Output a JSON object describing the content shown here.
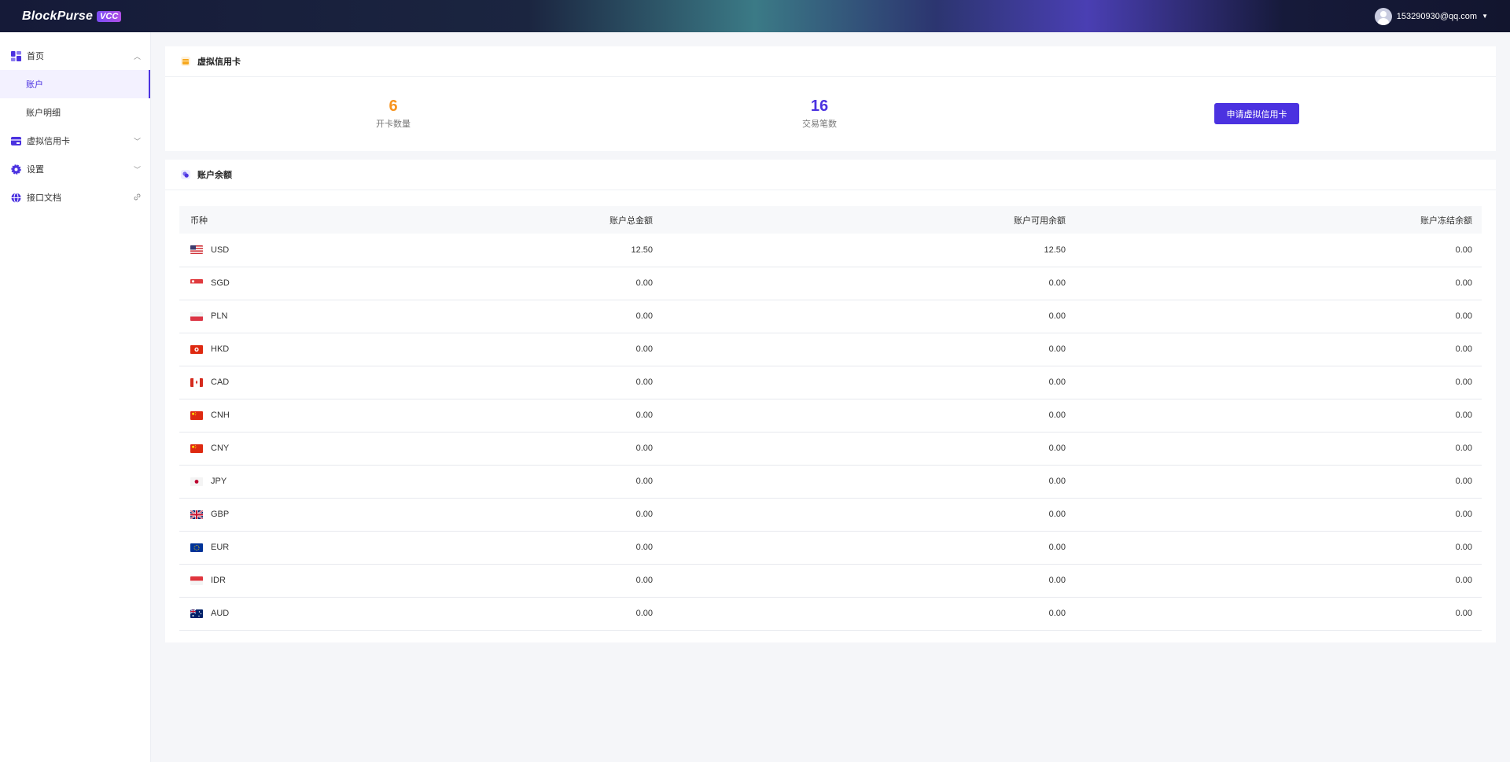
{
  "header": {
    "logo_text": "BlockPurse",
    "logo_badge": "VCC",
    "user_email": "153290930@qq.com"
  },
  "sidebar": {
    "items": [
      {
        "label": "首页",
        "icon": "dashboard-icon",
        "expanded": true
      },
      {
        "label": "账户",
        "sub": true,
        "active": true
      },
      {
        "label": "账户明细",
        "sub": true
      },
      {
        "label": "虚拟信用卡",
        "icon": "card-icon"
      },
      {
        "label": "设置",
        "icon": "gear-icon"
      },
      {
        "label": "接口文档",
        "icon": "globe-icon"
      }
    ]
  },
  "vcc_card": {
    "title": "虚拟信用卡",
    "open_count": "6",
    "open_count_label": "开卡数量",
    "txn_count": "16",
    "txn_count_label": "交易笔数",
    "apply_button": "申请虚拟信用卡",
    "colors": {
      "open_count": "#f7931e",
      "txn_count": "#4b32e0",
      "accent": "#4b32e0"
    }
  },
  "balance_card": {
    "title": "账户余额",
    "columns": [
      "币种",
      "账户总金额",
      "账户可用余额",
      "账户冻结余额"
    ],
    "rows": [
      {
        "currency": "USD",
        "total": "12.50",
        "available": "12.50",
        "frozen": "0.00"
      },
      {
        "currency": "SGD",
        "total": "0.00",
        "available": "0.00",
        "frozen": "0.00"
      },
      {
        "currency": "PLN",
        "total": "0.00",
        "available": "0.00",
        "frozen": "0.00"
      },
      {
        "currency": "HKD",
        "total": "0.00",
        "available": "0.00",
        "frozen": "0.00"
      },
      {
        "currency": "CAD",
        "total": "0.00",
        "available": "0.00",
        "frozen": "0.00"
      },
      {
        "currency": "CNH",
        "total": "0.00",
        "available": "0.00",
        "frozen": "0.00"
      },
      {
        "currency": "CNY",
        "total": "0.00",
        "available": "0.00",
        "frozen": "0.00"
      },
      {
        "currency": "JPY",
        "total": "0.00",
        "available": "0.00",
        "frozen": "0.00"
      },
      {
        "currency": "GBP",
        "total": "0.00",
        "available": "0.00",
        "frozen": "0.00"
      },
      {
        "currency": "EUR",
        "total": "0.00",
        "available": "0.00",
        "frozen": "0.00"
      },
      {
        "currency": "IDR",
        "total": "0.00",
        "available": "0.00",
        "frozen": "0.00"
      },
      {
        "currency": "AUD",
        "total": "0.00",
        "available": "0.00",
        "frozen": "0.00"
      }
    ]
  }
}
